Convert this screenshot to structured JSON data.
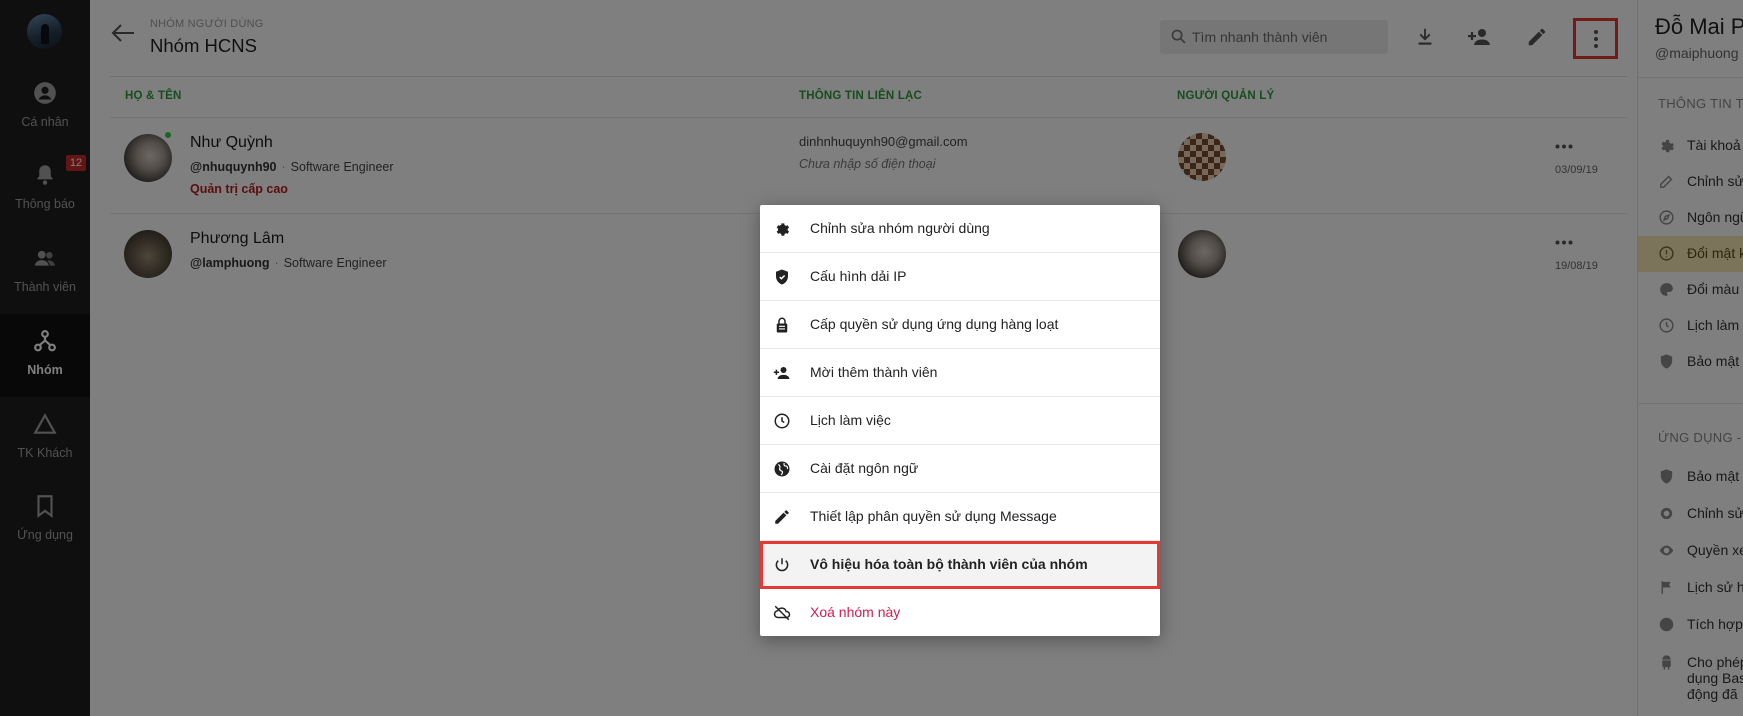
{
  "sidebar": {
    "items": [
      {
        "label": "Cá nhân",
        "icon": "person-icon"
      },
      {
        "label": "Thông báo",
        "icon": "bell-icon",
        "badge": "12"
      },
      {
        "label": "Thành viên",
        "icon": "members-icon"
      },
      {
        "label": "Nhóm",
        "icon": "group-icon",
        "active": true
      },
      {
        "label": "TK Khách",
        "icon": "triangle-icon"
      },
      {
        "label": "Ứng dụng",
        "icon": "bookmark-icon"
      }
    ]
  },
  "header": {
    "breadcrumb": "NHÓM NGƯỜI DÙNG",
    "title": "Nhóm HCNS",
    "search_placeholder": "Tìm nhanh thành viên"
  },
  "table": {
    "columns": [
      "HỌ & TÊN",
      "THÔNG TIN LIÊN LẠC",
      "NGƯỜI QUẢN LÝ"
    ],
    "rows": [
      {
        "name": "Như Quỳnh",
        "username": "@nhuquynh90",
        "title": "Software Engineer",
        "role": "Quản trị cấp cao",
        "email": "dinhnhuquynh90@gmail.com",
        "phone": "Chưa nhập số điện thoại",
        "date": "03/09/19",
        "online": true
      },
      {
        "name": "Phương Lâm",
        "username": "@lamphuong",
        "title": "Software Engineer",
        "date": "19/08/19"
      }
    ]
  },
  "menu": {
    "items": [
      {
        "label": "Chỉnh sửa nhóm người dùng",
        "icon": "gear-icon"
      },
      {
        "label": "Cấu hình dải IP",
        "icon": "shield-icon"
      },
      {
        "label": "Cấp quyền sử dụng ứng dụng hàng loạt",
        "icon": "lock-icon"
      },
      {
        "label": "Mời thêm thành viên",
        "icon": "person-add-icon"
      },
      {
        "label": "Lịch làm việc",
        "icon": "clock-icon"
      },
      {
        "label": "Cài đặt ngôn ngữ",
        "icon": "globe-icon"
      },
      {
        "label": "Thiết lập phân quyền sử dụng Message",
        "icon": "pencil-icon"
      },
      {
        "label": "Vô hiệu hóa toàn bộ thành viên của nhóm",
        "icon": "power-icon",
        "selected": true
      },
      {
        "label": "Xoá nhóm này",
        "icon": "cloud-off-icon",
        "danger": true
      }
    ]
  },
  "right_panel": {
    "name": "Đỗ Mai P",
    "username": "@maiphuong",
    "section1": "THÔNG TIN T",
    "items1": [
      "Tài khoả",
      "Chỉnh sử",
      "Ngôn ngữ",
      "Đổi mật k",
      "Đổi màu",
      "Lịch làm",
      "Bảo mật"
    ],
    "section2": "ỨNG DỤNG - I",
    "items2": [
      "Bảo mật",
      "Chỉnh sử",
      "Quyền xe",
      "Lịch sử h",
      "Tích hợp"
    ],
    "multi": [
      "Cho phép",
      "dụng Bas",
      "động đã"
    ]
  },
  "colors": {
    "accent_green": "#2e9a3a",
    "highlight_red": "#e53935",
    "danger_pink": "#d81b4b"
  }
}
